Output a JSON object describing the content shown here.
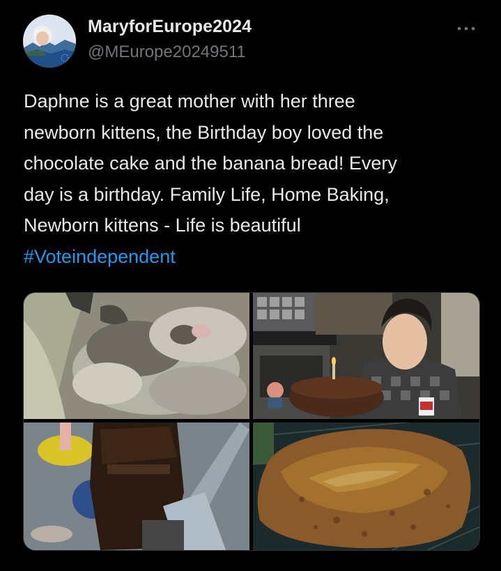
{
  "author": {
    "display_name": "MaryforEurope2024",
    "handle": "@MEurope20249511"
  },
  "tweet": {
    "text_lines": [
      "Daphne is a great mother with her three",
      "newborn kittens, the Birthday boy loved the",
      "chocolate cake and the banana bread! Every",
      "day is a birthday. Family Life, Home Baking,",
      "Newborn kittens - Life is beautiful"
    ],
    "hashtag": "#Voteindependent"
  },
  "media": [
    {
      "icon": "kittens-photo"
    },
    {
      "icon": "birthday-boy-cake-photo"
    },
    {
      "icon": "chocolate-cake-slice-photo"
    },
    {
      "icon": "banana-bread-photo"
    }
  ],
  "colors": {
    "background": "#000000",
    "text": "#e7e9ea",
    "secondary": "#71767b",
    "link": "#1d9bf0"
  }
}
